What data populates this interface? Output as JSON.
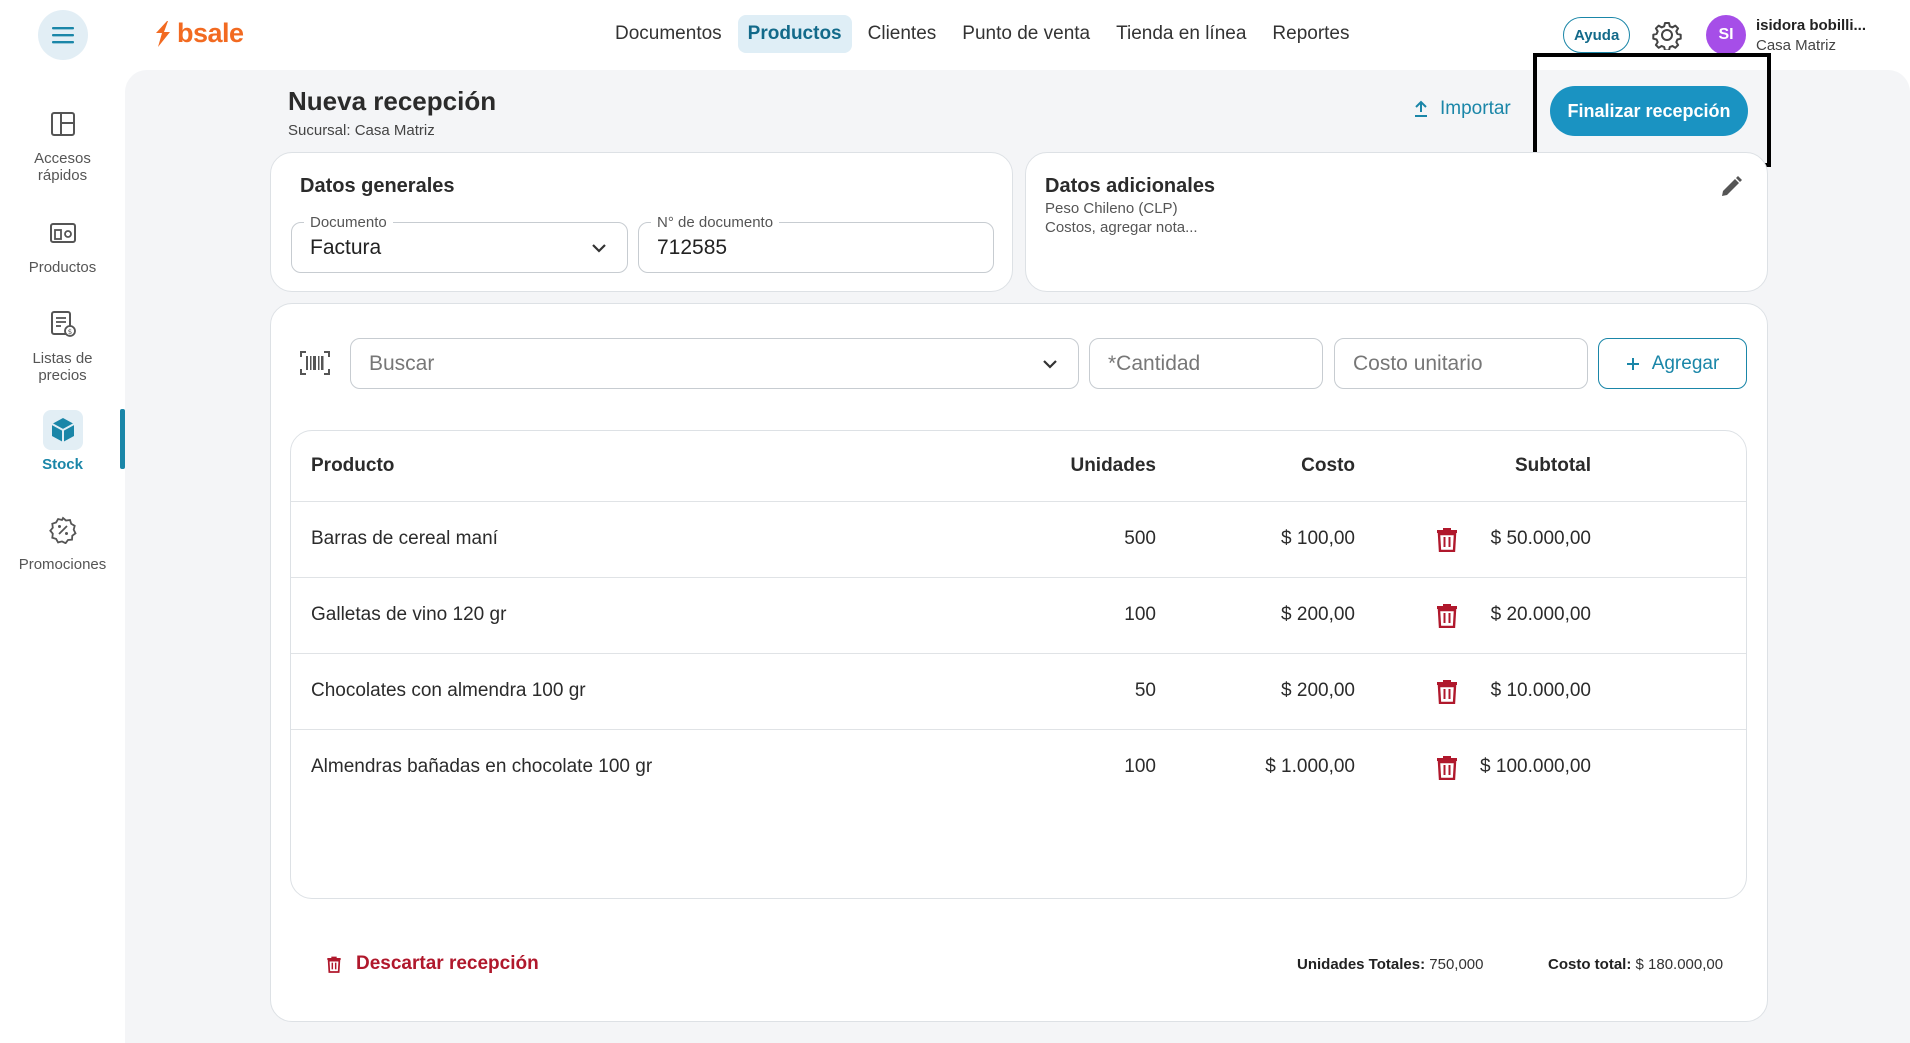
{
  "brand": {
    "name": "bsale",
    "color": "#f26a21"
  },
  "nav": {
    "items": [
      {
        "label": "Documentos"
      },
      {
        "label": "Productos",
        "active": true
      },
      {
        "label": "Clientes"
      },
      {
        "label": "Punto de venta"
      },
      {
        "label": "Tienda en línea"
      },
      {
        "label": "Reportes"
      }
    ]
  },
  "header": {
    "help_label": "Ayuda",
    "user_initials": "SI",
    "user_name": "isidora bobilli...",
    "user_branch": "Casa Matriz"
  },
  "sidebar": {
    "items": [
      {
        "label": "Accesos\nrápidos",
        "icon": "layout-icon"
      },
      {
        "label": "Productos",
        "icon": "products-icon"
      },
      {
        "label": "Listas de\nprecios",
        "icon": "price-list-icon"
      },
      {
        "label": "Stock",
        "icon": "box-icon",
        "active": true
      },
      {
        "label": "Promociones",
        "icon": "discount-icon"
      }
    ]
  },
  "page": {
    "title": "Nueva recepción",
    "subtitle": "Sucursal: Casa Matriz",
    "import_label": "Importar",
    "finish_label": "Finalizar recepción"
  },
  "general": {
    "title": "Datos generales",
    "document_label": "Documento",
    "document_value": "Factura",
    "docnum_label": "N° de documento",
    "docnum_value": "712585"
  },
  "additional": {
    "title": "Datos adicionales",
    "currency": "Peso Chileno (CLP)",
    "note": "Costos, agregar nota..."
  },
  "entry": {
    "search_placeholder": "Buscar",
    "qty_placeholder": "*Cantidad",
    "cost_placeholder": "Costo unitario",
    "add_label": "Agregar"
  },
  "table": {
    "headers": {
      "product": "Producto",
      "units": "Unidades",
      "cost": "Costo",
      "subtotal": "Subtotal"
    },
    "rows": [
      {
        "product": "Barras de cereal maní",
        "units": "500",
        "cost": "$ 100,00",
        "subtotal": "$ 50.000,00"
      },
      {
        "product": "Galletas de vino 120 gr",
        "units": "100",
        "cost": "$ 200,00",
        "subtotal": "$ 20.000,00"
      },
      {
        "product": "Chocolates con almendra 100 gr",
        "units": "50",
        "cost": "$ 200,00",
        "subtotal": "$ 10.000,00"
      },
      {
        "product": "Almendras bañadas en chocolate 100 gr",
        "units": "100",
        "cost": "$ 1.000,00",
        "subtotal": "$ 100.000,00"
      }
    ]
  },
  "footer": {
    "discard_label": "Descartar recepción",
    "units_total_label": "Unidades Totales:",
    "units_total_value": "750,000",
    "cost_total_label": "Costo total:",
    "cost_total_value": "$ 180.000,00"
  },
  "colors": {
    "accent": "#1a86a8",
    "primary_button": "#1a93c2",
    "danger": "#b0182c",
    "avatar": "#a64ee8"
  }
}
